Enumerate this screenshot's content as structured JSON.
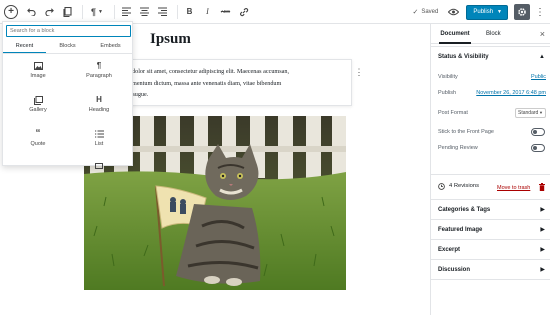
{
  "toolbar": {
    "add_label": "+",
    "paragraph_glyph": "¶",
    "bold_label": "B",
    "italic_label": "I",
    "strike_label": "ABC",
    "saved_label": "Saved",
    "publish_label": "Publish",
    "icons": [
      "add-block-icon",
      "undo-icon",
      "redo-icon",
      "content-structure-icon",
      "paragraph-icon",
      "align-left-icon",
      "align-center-icon",
      "align-right-icon",
      "bold-icon",
      "italic-icon",
      "strikethrough-icon",
      "link-icon",
      "eye-icon",
      "gear-icon",
      "more-menu-icon"
    ],
    "accent_color": "#0085ba"
  },
  "editor": {
    "title": "Ipsum",
    "paragraph_lines": [
      "dolor sit amet, consectetur adipiscing elit. Maecenas accumsan,",
      "mentum dictum, massa ante venenatis diam, vitae bibendum",
      "augue."
    ],
    "image_icon": "cat-photo"
  },
  "inserter": {
    "search_placeholder": "Search for a block",
    "tabs": [
      {
        "label": "Recent",
        "active": true
      },
      {
        "label": "Blocks",
        "active": false
      },
      {
        "label": "Embeds",
        "active": false
      }
    ],
    "items": [
      {
        "label": "Image",
        "icon": "image-icon"
      },
      {
        "label": "Paragraph",
        "icon": "paragraph-icon"
      },
      {
        "label": "Gallery",
        "icon": "gallery-icon"
      },
      {
        "label": "Heading",
        "icon": "heading-icon"
      },
      {
        "label": "Quote",
        "icon": "quote-icon"
      },
      {
        "label": "List",
        "icon": "list-icon"
      }
    ]
  },
  "sidebar": {
    "tab_document": "Document",
    "tab_block": "Block",
    "status_visibility": "Status & Visibility",
    "visibility_label": "Visibility",
    "visibility_value": "Public",
    "publish_label": "Publish",
    "publish_value": "November 26, 2017 6:48 pm",
    "post_format_label": "Post Format",
    "post_format_value": "Standard",
    "sticky_label": "Stick to the Front Page",
    "pending_label": "Pending Review",
    "trash_label": "Move to trash",
    "revisions_label": "4 Revisions",
    "categories_label": "Categories & Tags",
    "featured_image_label": "Featured Image",
    "excerpt_label": "Excerpt",
    "discussion_label": "Discussion"
  }
}
